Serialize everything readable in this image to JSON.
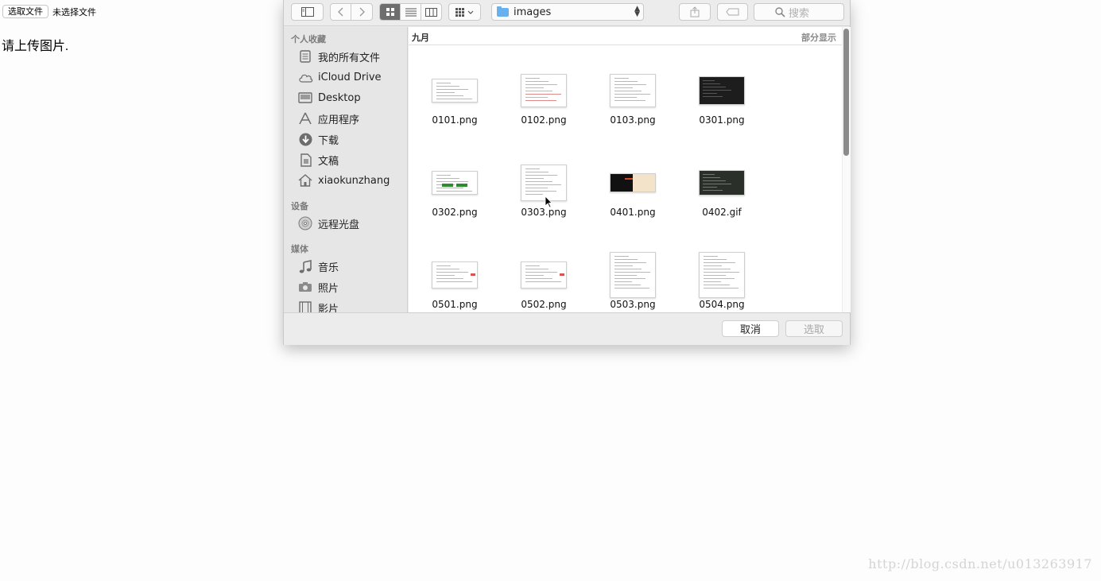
{
  "page": {
    "file_button": "选取文件",
    "file_status": "未选择文件",
    "prompt": "请上传图片.",
    "watermark": "http://blog.csdn.net/u013263917"
  },
  "dialog": {
    "path": "images",
    "search_placeholder": "搜索",
    "sidebar": {
      "sections": [
        {
          "title": "个人收藏",
          "items": [
            {
              "label": "我的所有文件",
              "icon": "all-files-icon"
            },
            {
              "label": "iCloud Drive",
              "icon": "cloud-icon"
            },
            {
              "label": "Desktop",
              "icon": "desktop-icon"
            },
            {
              "label": "应用程序",
              "icon": "applications-icon"
            },
            {
              "label": "下载",
              "icon": "download-icon"
            },
            {
              "label": "文稿",
              "icon": "documents-icon"
            },
            {
              "label": "xiaokunzhang",
              "icon": "home-icon"
            }
          ]
        },
        {
          "title": "设备",
          "items": [
            {
              "label": "远程光盘",
              "icon": "disc-icon"
            }
          ]
        },
        {
          "title": "媒体",
          "items": [
            {
              "label": "音乐",
              "icon": "music-icon"
            },
            {
              "label": "照片",
              "icon": "camera-icon"
            },
            {
              "label": "影片",
              "icon": "film-icon"
            }
          ]
        }
      ]
    },
    "group": {
      "title": "九月",
      "show_partial": "部分显示"
    },
    "files": [
      {
        "name": "0101.png",
        "kind": "doc-wide"
      },
      {
        "name": "0102.png",
        "kind": "doc-red"
      },
      {
        "name": "0103.png",
        "kind": "doc"
      },
      {
        "name": "0301.png",
        "kind": "dark"
      },
      {
        "name": "0302.png",
        "kind": "green-buttons"
      },
      {
        "name": "0303.png",
        "kind": "dialog"
      },
      {
        "name": "0401.png",
        "kind": "dark-split"
      },
      {
        "name": "0402.gif",
        "kind": "code"
      },
      {
        "name": "0501.png",
        "kind": "web"
      },
      {
        "name": "0502.png",
        "kind": "web"
      },
      {
        "name": "0503.png",
        "kind": "doc-tall"
      },
      {
        "name": "0504.png",
        "kind": "doc-tall"
      }
    ],
    "buttons": {
      "cancel": "取消",
      "choose": "选取"
    }
  }
}
